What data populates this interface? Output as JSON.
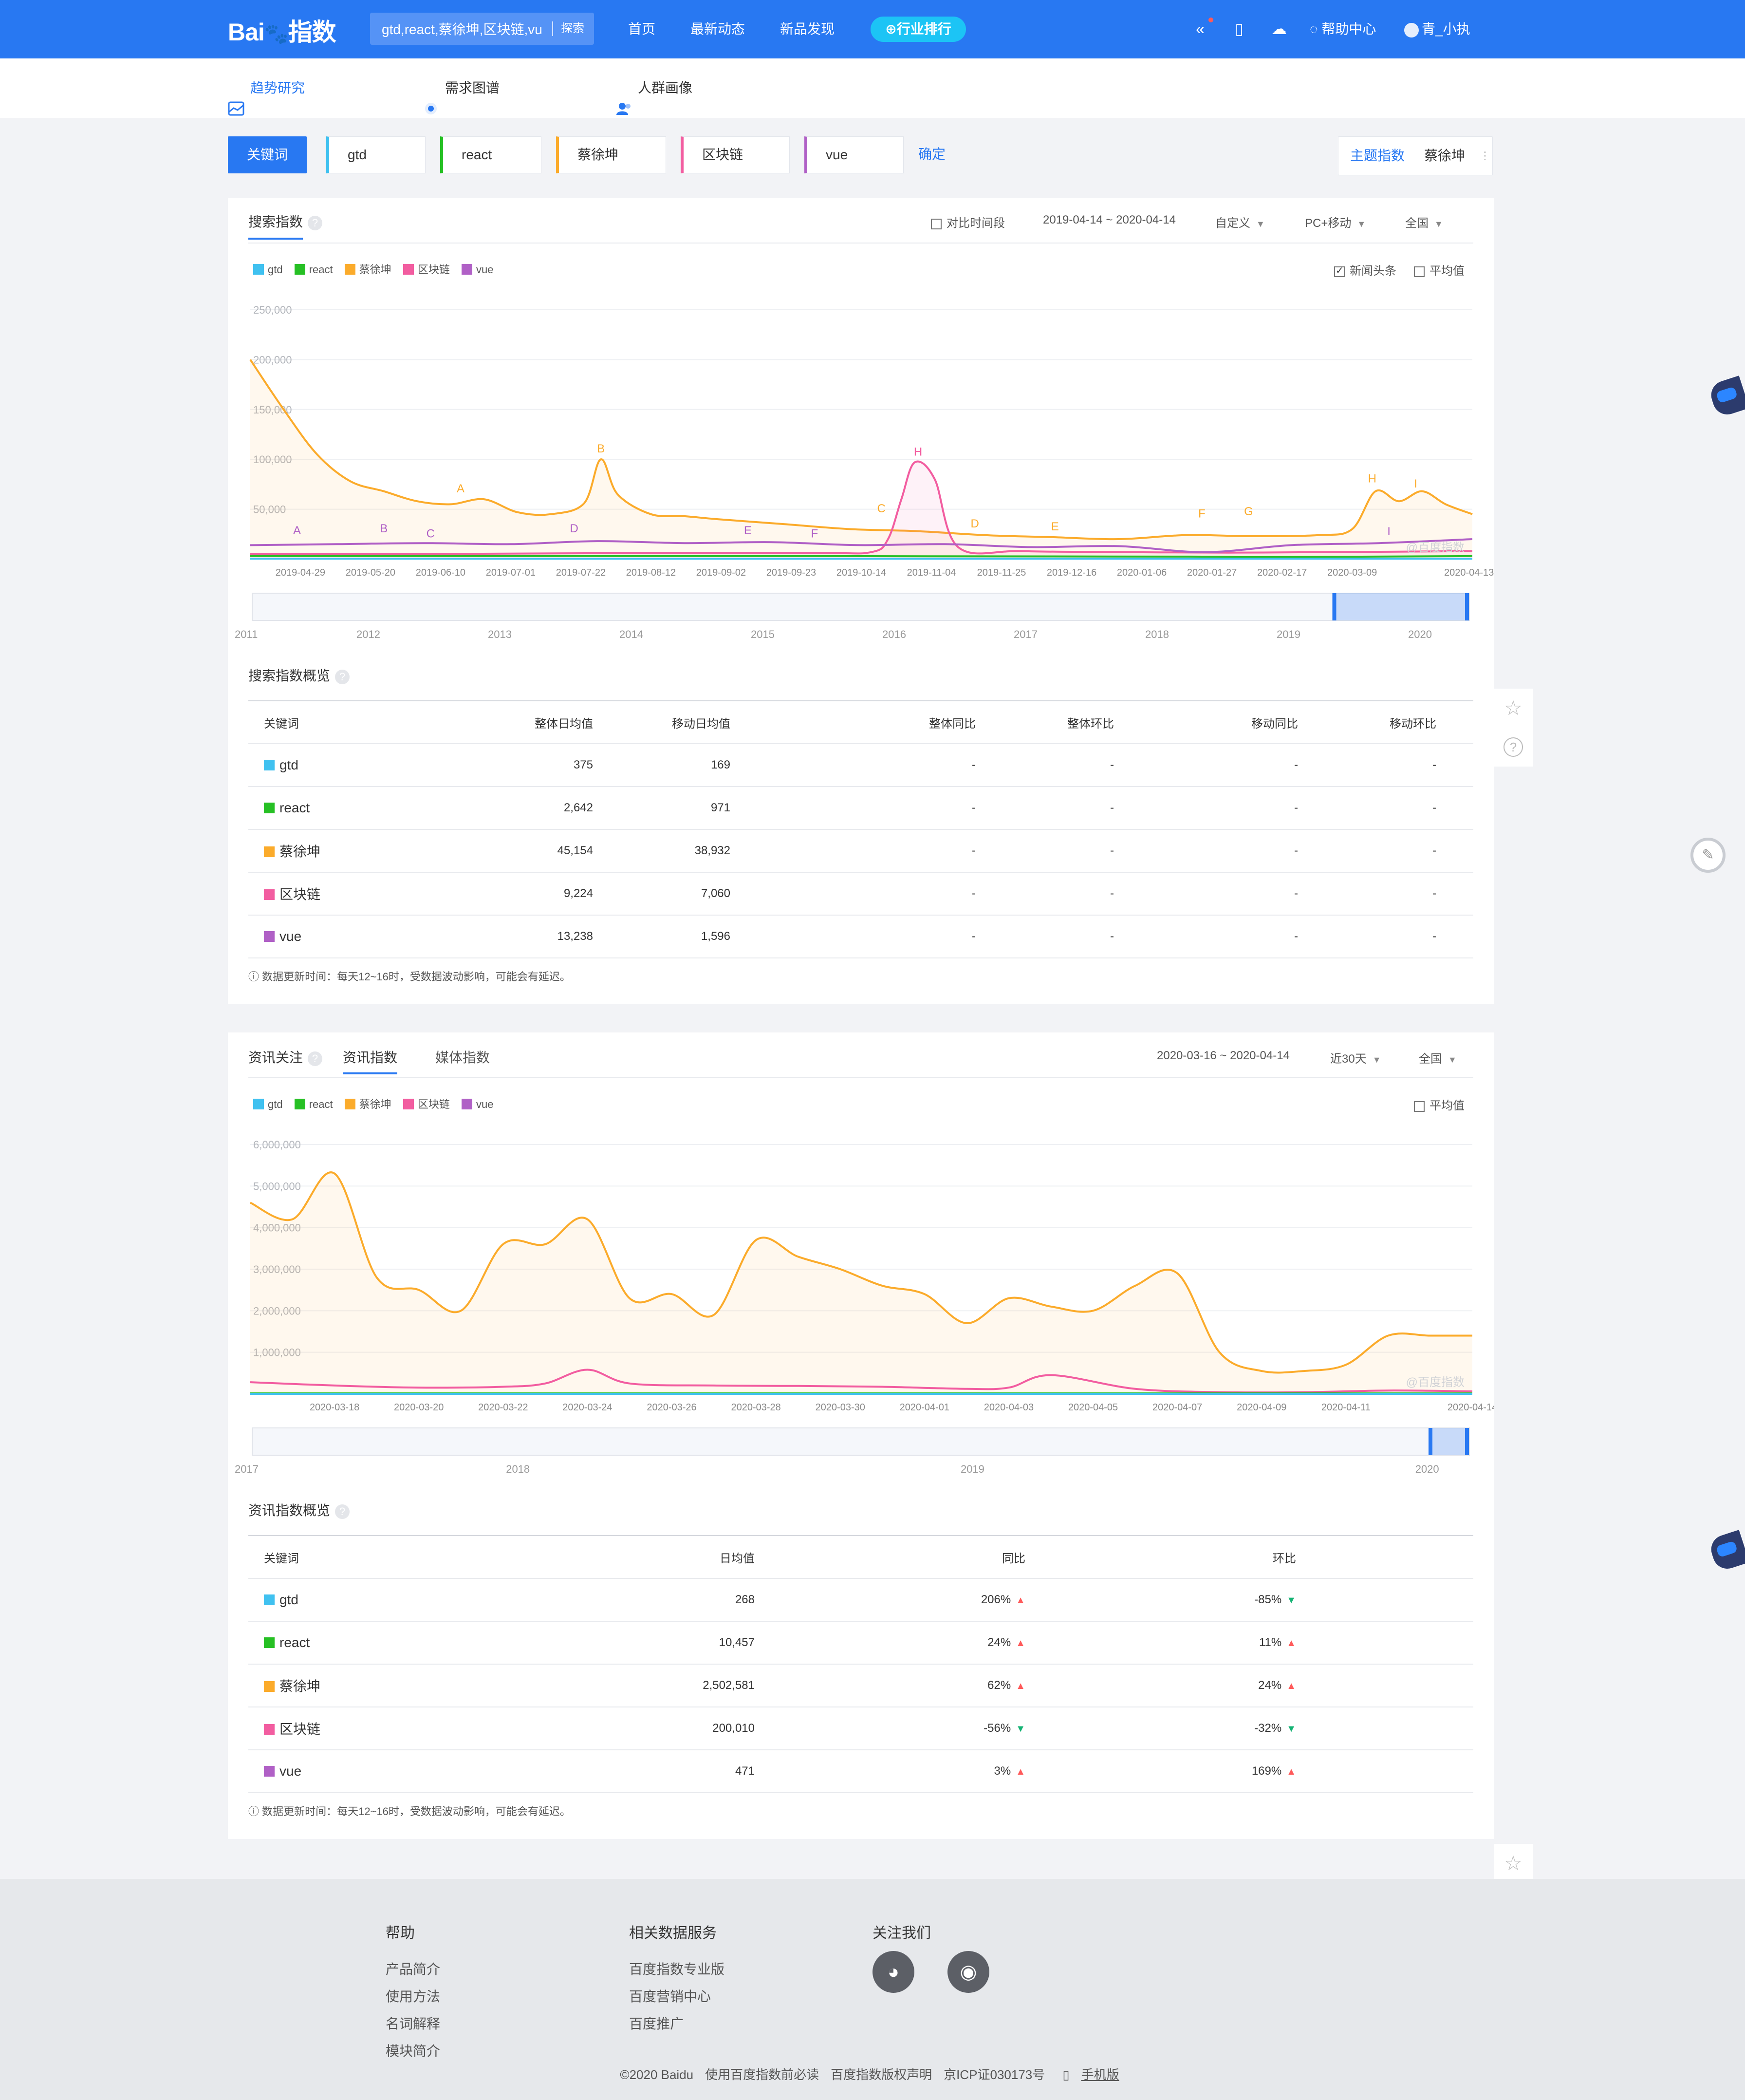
{
  "header": {
    "logo_text": "Bai",
    "logo_suffix": "指数",
    "search_value": "gtd,react,蔡徐坤,区块链,vue",
    "search_button": "探索",
    "nav": [
      "首页",
      "最新动态",
      "新品发现"
    ],
    "rank_label": "行业排行",
    "help_label": "帮助中心",
    "user_name": "青_小执"
  },
  "subnav": {
    "trend": "趋势研究",
    "demand": "需求图谱",
    "crowd": "人群画像"
  },
  "keywords": {
    "label": "关键词",
    "items": [
      {
        "name": "gtd",
        "color": "#40c1f0"
      },
      {
        "name": "react",
        "color": "#26c024"
      },
      {
        "name": "蔡徐坤",
        "color": "#fbab2b"
      },
      {
        "name": "区块链",
        "color": "#f25da0"
      },
      {
        "name": "vue",
        "color": "#b060c6"
      }
    ],
    "confirm": "确定",
    "theme_index": "主题指数",
    "theme_value": "蔡徐坤"
  },
  "search_card": {
    "title": "搜索指数",
    "compare_label": "对比时间段",
    "date_range": "2019-04-14 ~ 2020-04-14",
    "period": "自定义",
    "device": "PC+移动",
    "region": "全国",
    "news_label": "新闻头条",
    "avg_label": "平均值",
    "watermark": "@百度指数",
    "slider_years": [
      "2011",
      "2012",
      "2013",
      "2014",
      "2015",
      "2016",
      "2017",
      "2018",
      "2019",
      "2020"
    ]
  },
  "search_overview": {
    "title": "搜索指数概览",
    "headers": [
      "关键词",
      "整体日均值",
      "移动日均值",
      "整体同比",
      "整体环比",
      "移动同比",
      "移动环比"
    ],
    "rows": [
      {
        "kw": "gtd",
        "overall": "375",
        "mobile": "169",
        "o_yoy": "-",
        "o_mom": "-",
        "m_yoy": "-",
        "m_mom": "-"
      },
      {
        "kw": "react",
        "overall": "2,642",
        "mobile": "971",
        "o_yoy": "-",
        "o_mom": "-",
        "m_yoy": "-",
        "m_mom": "-"
      },
      {
        "kw": "蔡徐坤",
        "overall": "45,154",
        "mobile": "38,932",
        "o_yoy": "-",
        "o_mom": "-",
        "m_yoy": "-",
        "m_mom": "-"
      },
      {
        "kw": "区块链",
        "overall": "9,224",
        "mobile": "7,060",
        "o_yoy": "-",
        "o_mom": "-",
        "m_yoy": "-",
        "m_mom": "-"
      },
      {
        "kw": "vue",
        "overall": "13,238",
        "mobile": "1,596",
        "o_yoy": "-",
        "o_mom": "-",
        "m_yoy": "-",
        "m_mom": "-"
      }
    ],
    "note": "数据更新时间：每天12~16时，受数据波动影响，可能会有延迟。"
  },
  "news_card": {
    "title": "资讯关注",
    "tab1": "资讯指数",
    "tab2": "媒体指数",
    "date_range": "2020-03-16 ~ 2020-04-14",
    "period": "近30天",
    "region": "全国",
    "avg_label": "平均值",
    "watermark": "@百度指数",
    "slider_years": [
      "2017",
      "2018",
      "2019",
      "2020"
    ]
  },
  "news_overview": {
    "title": "资讯指数概览",
    "headers": [
      "关键词",
      "日均值",
      "同比",
      "环比"
    ],
    "rows": [
      {
        "kw": "gtd",
        "avg": "268",
        "yoy": "206%",
        "yoy_dir": "up",
        "mom": "-85%",
        "mom_dir": "down"
      },
      {
        "kw": "react",
        "avg": "10,457",
        "yoy": "24%",
        "yoy_dir": "up",
        "mom": "11%",
        "mom_dir": "up"
      },
      {
        "kw": "蔡徐坤",
        "avg": "2,502,581",
        "yoy": "62%",
        "yoy_dir": "up",
        "mom": "24%",
        "mom_dir": "up"
      },
      {
        "kw": "区块链",
        "avg": "200,010",
        "yoy": "-56%",
        "yoy_dir": "down",
        "mom": "-32%",
        "mom_dir": "down"
      },
      {
        "kw": "vue",
        "avg": "471",
        "yoy": "3%",
        "yoy_dir": "up",
        "mom": "169%",
        "mom_dir": "up"
      }
    ],
    "note": "数据更新时间：每天12~16时，受数据波动影响，可能会有延迟。"
  },
  "chart_data": [
    {
      "type": "line",
      "title": "搜索指数",
      "ylim": [
        0,
        250000
      ],
      "y_ticks": [
        "250,000",
        "200,000",
        "150,000",
        "100,000",
        "50,000"
      ],
      "y_tick_values": [
        250000,
        200000,
        150000,
        100000,
        50000
      ],
      "x_ticks": [
        "2019-04-29",
        "2019-05-20",
        "2019-06-10",
        "2019-07-01",
        "2019-07-22",
        "2019-08-12",
        "2019-09-02",
        "2019-09-23",
        "2019-10-14",
        "2019-11-04",
        "2019-11-25",
        "2019-12-16",
        "2020-01-06",
        "2020-01-27",
        "2020-02-17",
        "2020-03-09",
        "2020-04-13"
      ],
      "x_range": [
        "2019-04-14",
        "2020-04-14"
      ],
      "series": [
        {
          "name": "蔡徐坤",
          "color": "#fbab2b",
          "fill": true,
          "x": [
            "2019-04-14",
            "2019-04-24",
            "2019-05-04",
            "2019-05-14",
            "2019-05-24",
            "2019-06-03",
            "2019-06-13",
            "2019-06-23",
            "2019-07-03",
            "2019-07-13",
            "2019-07-23",
            "2019-07-28",
            "2019-08-02",
            "2019-08-12",
            "2019-08-22",
            "2019-09-01",
            "2019-09-21",
            "2019-10-11",
            "2019-10-31",
            "2019-11-20",
            "2019-12-10",
            "2019-12-30",
            "2020-01-19",
            "2020-02-08",
            "2020-02-28",
            "2020-03-09",
            "2020-03-16",
            "2020-03-23",
            "2020-03-30",
            "2020-04-06",
            "2020-04-14"
          ],
          "y": [
            200000,
            150000,
            105000,
            78000,
            68000,
            58000,
            55000,
            60000,
            47000,
            45000,
            56000,
            100000,
            65000,
            45000,
            43000,
            40000,
            35000,
            30000,
            28000,
            24000,
            22000,
            20000,
            24000,
            23000,
            24000,
            30000,
            68000,
            58000,
            68000,
            55000,
            45000
          ]
        },
        {
          "name": "区块链",
          "color": "#f25da0",
          "fill": true,
          "x": [
            "2019-04-14",
            "2019-06-01",
            "2019-08-01",
            "2019-10-01",
            "2019-10-17",
            "2019-10-22",
            "2019-10-26",
            "2019-10-30",
            "2019-11-05",
            "2019-11-12",
            "2019-12-01",
            "2020-01-01",
            "2020-02-01",
            "2020-03-01",
            "2020-04-14"
          ],
          "y": [
            5000,
            5000,
            6000,
            6000,
            7000,
            20000,
            60000,
            97000,
            80000,
            12000,
            8000,
            7000,
            6500,
            7000,
            8000
          ]
        },
        {
          "name": "vue",
          "color": "#b060c6",
          "fill": false,
          "x": [
            "2019-04-14",
            "2019-05-10",
            "2019-06-05",
            "2019-07-01",
            "2019-07-27",
            "2019-08-22",
            "2019-09-17",
            "2019-10-13",
            "2019-11-08",
            "2019-12-04",
            "2019-12-30",
            "2020-01-25",
            "2020-02-20",
            "2020-03-17",
            "2020-04-14"
          ],
          "y": [
            14000,
            15000,
            16000,
            15000,
            18000,
            16000,
            17000,
            14000,
            15000,
            12000,
            13000,
            7000,
            14000,
            16000,
            20000
          ]
        },
        {
          "name": "react",
          "color": "#26c024",
          "fill": false,
          "x": [
            "2019-04-14",
            "2019-10-01",
            "2020-01-20",
            "2020-02-10",
            "2020-04-14"
          ],
          "y": [
            3000,
            3000,
            2500,
            2000,
            3000
          ]
        },
        {
          "name": "gtd",
          "color": "#40c1f0",
          "fill": false,
          "x": [
            "2019-04-14",
            "2020-04-14"
          ],
          "y": [
            400,
            400
          ]
        }
      ],
      "annotations": [
        {
          "label": "A",
          "series": "蔡徐坤",
          "x": "2019-06-16",
          "y": 60000
        },
        {
          "label": "B",
          "series": "蔡徐坤",
          "x": "2019-07-28",
          "y": 100000
        },
        {
          "label": "C",
          "series": "蔡徐坤",
          "x": "2019-10-20",
          "y": 40000
        },
        {
          "label": "D",
          "series": "蔡徐坤",
          "x": "2019-11-17",
          "y": 25000
        },
        {
          "label": "E",
          "series": "蔡徐坤",
          "x": "2019-12-11",
          "y": 22000
        },
        {
          "label": "F",
          "series": "蔡徐坤",
          "x": "2020-01-24",
          "y": 35000
        },
        {
          "label": "G",
          "series": "蔡徐坤",
          "x": "2020-02-07",
          "y": 37000
        },
        {
          "label": "H",
          "series": "蔡徐坤",
          "x": "2020-03-15",
          "y": 70000
        },
        {
          "label": "I",
          "series": "蔡徐坤",
          "x": "2020-03-28",
          "y": 65000
        },
        {
          "label": "H",
          "series": "区块链",
          "x": "2019-10-31",
          "y": 97000
        },
        {
          "label": "A",
          "series": "vue",
          "x": "2019-04-28",
          "y": 18000
        },
        {
          "label": "B",
          "series": "vue",
          "x": "2019-05-24",
          "y": 20000
        },
        {
          "label": "C",
          "series": "vue",
          "x": "2019-06-07",
          "y": 15000
        },
        {
          "label": "D",
          "series": "vue",
          "x": "2019-07-20",
          "y": 20000
        },
        {
          "label": "E",
          "series": "vue",
          "x": "2019-09-10",
          "y": 18000
        },
        {
          "label": "F",
          "series": "vue",
          "x": "2019-09-30",
          "y": 15000
        },
        {
          "label": "I",
          "series": "vue",
          "x": "2020-03-20",
          "y": 17000
        }
      ]
    },
    {
      "type": "line",
      "title": "资讯指数",
      "ylim": [
        0,
        6000000
      ],
      "y_ticks": [
        "6,000,000",
        "5,000,000",
        "4,000,000",
        "3,000,000",
        "2,000,000",
        "1,000,000"
      ],
      "y_tick_values": [
        6000000,
        5000000,
        4000000,
        3000000,
        2000000,
        1000000
      ],
      "x_ticks": [
        "2020-03-18",
        "2020-03-20",
        "2020-03-22",
        "2020-03-24",
        "2020-03-26",
        "2020-03-28",
        "2020-03-30",
        "2020-04-01",
        "2020-04-03",
        "2020-04-05",
        "2020-04-07",
        "2020-04-09",
        "2020-04-11",
        "2020-04-14"
      ],
      "x_range": [
        "2020-03-16",
        "2020-04-14"
      ],
      "series": [
        {
          "name": "蔡徐坤",
          "color": "#fbab2b",
          "fill": true,
          "x": [
            "2020-03-16",
            "2020-03-17",
            "2020-03-18",
            "2020-03-19",
            "2020-03-20",
            "2020-03-21",
            "2020-03-22",
            "2020-03-23",
            "2020-03-24",
            "2020-03-25",
            "2020-03-26",
            "2020-03-27",
            "2020-03-28",
            "2020-03-29",
            "2020-03-30",
            "2020-03-31",
            "2020-04-01",
            "2020-04-02",
            "2020-04-03",
            "2020-04-04",
            "2020-04-05",
            "2020-04-06",
            "2020-04-07",
            "2020-04-08",
            "2020-04-09",
            "2020-04-10",
            "2020-04-11",
            "2020-04-12",
            "2020-04-13",
            "2020-04-14"
          ],
          "y": [
            4600000,
            4200000,
            5300000,
            2800000,
            2500000,
            2000000,
            3600000,
            3600000,
            4200000,
            2300000,
            2400000,
            1900000,
            3700000,
            3300000,
            3000000,
            2600000,
            2400000,
            1700000,
            2300000,
            2100000,
            2000000,
            2600000,
            2900000,
            1000000,
            550000,
            550000,
            700000,
            1400000,
            1400000,
            1400000
          ]
        },
        {
          "name": "区块链",
          "color": "#f25da0",
          "fill": false,
          "x": [
            "2020-03-16",
            "2020-03-18",
            "2020-03-20",
            "2020-03-22",
            "2020-03-23",
            "2020-03-24",
            "2020-03-25",
            "2020-03-27",
            "2020-03-29",
            "2020-03-31",
            "2020-04-02",
            "2020-04-03",
            "2020-04-04",
            "2020-04-06",
            "2020-04-08",
            "2020-04-10",
            "2020-04-12",
            "2020-04-14"
          ],
          "y": [
            280000,
            200000,
            150000,
            170000,
            250000,
            580000,
            250000,
            200000,
            190000,
            170000,
            120000,
            150000,
            450000,
            120000,
            40000,
            40000,
            80000,
            60000
          ]
        },
        {
          "name": "react",
          "color": "#26c024",
          "fill": false,
          "x": [
            "2020-03-16",
            "2020-04-14"
          ],
          "y": [
            10000,
            10000
          ]
        },
        {
          "name": "vue",
          "color": "#b060c6",
          "fill": false,
          "x": [
            "2020-03-16",
            "2020-04-14"
          ],
          "y": [
            500,
            500
          ]
        },
        {
          "name": "gtd",
          "color": "#40c1f0",
          "fill": false,
          "x": [
            "2020-03-16",
            "2020-04-14"
          ],
          "y": [
            300,
            300
          ]
        }
      ]
    }
  ],
  "footer": {
    "help_title": "帮助",
    "help_links": [
      "产品简介",
      "使用方法",
      "名词解释",
      "模块简介"
    ],
    "related_title": "相关数据服务",
    "related_links": [
      "百度指数专业版",
      "百度营销中心",
      "百度推广"
    ],
    "follow_title": "关注我们",
    "copyright": "©2020 Baidu",
    "copy_links": [
      "使用百度指数前必读",
      "百度指数版权声明",
      "京ICP证030173号",
      "手机版"
    ]
  }
}
